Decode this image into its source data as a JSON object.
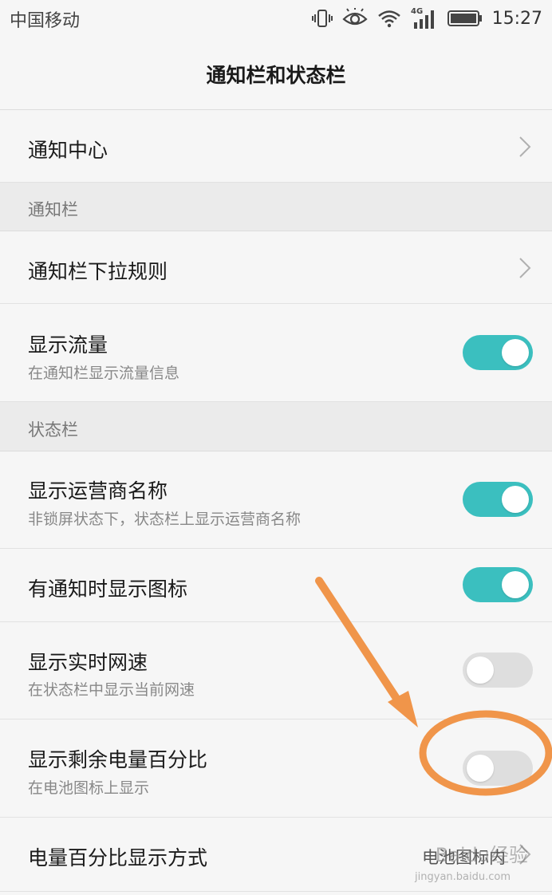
{
  "status_bar": {
    "carrier": "中国移动",
    "network_badge": "4G",
    "time": "15:27",
    "icons": [
      "vibrate-icon",
      "eye-icon",
      "wifi-icon",
      "signal-icon",
      "battery-icon"
    ]
  },
  "header": {
    "title": "通知栏和状态栏"
  },
  "items": {
    "notification_center": {
      "label": "通知中心"
    },
    "section_notification": {
      "label": "通知栏"
    },
    "pulldown_rule": {
      "label": "通知栏下拉规则"
    },
    "show_traffic": {
      "label": "显示流量",
      "sub": "在通知栏显示流量信息",
      "enabled": true
    },
    "section_status": {
      "label": "状态栏"
    },
    "show_carrier": {
      "label": "显示运营商名称",
      "sub": "非锁屏状态下，状态栏上显示运营商名称",
      "enabled": true
    },
    "show_notif_icons": {
      "label": "有通知时显示图标",
      "enabled": true
    },
    "show_net_speed": {
      "label": "显示实时网速",
      "sub": "在状态栏中显示当前网速",
      "enabled": false
    },
    "show_battery_pct": {
      "label": "显示剩余电量百分比",
      "sub": "在电池图标上显示",
      "enabled": false
    },
    "battery_pct_mode": {
      "label": "电量百分比显示方式",
      "value": "电池图标内"
    }
  },
  "watermark": {
    "text": "Baidu经验",
    "url": "jingyan.baidu.com"
  },
  "colors": {
    "toggle_on": "#3bbfbf",
    "toggle_off": "#dedede",
    "annotation": "#f0954a"
  }
}
